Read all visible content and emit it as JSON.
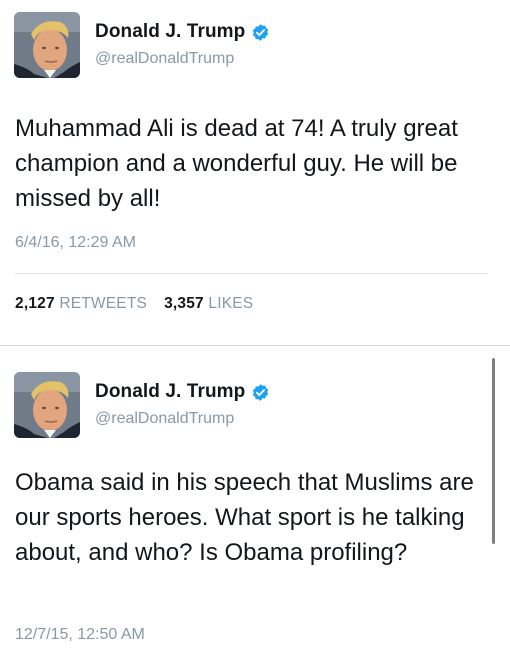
{
  "tweets": [
    {
      "display_name": "Donald J. Trump",
      "handle": "@realDonaldTrump",
      "text": "Muhammad Ali is dead at 74! A truly great champion and a wonderful guy. He will be missed by all!",
      "timestamp": "6/4/16, 12:29 AM",
      "retweets_count": "2,127",
      "retweets_label": "RETWEETS",
      "likes_count": "3,357",
      "likes_label": "LIKES"
    },
    {
      "display_name": "Donald J. Trump",
      "handle": "@realDonaldTrump",
      "text": "Obama said in his speech that Muslims are our sports heroes. What sport is he talking about, and who? Is Obama profiling?",
      "timestamp": "12/7/15, 12:50 AM"
    }
  ],
  "icons": {
    "verified": "verified-badge-icon",
    "avatar": "profile-photo"
  },
  "colors": {
    "verified_blue": "#1da1f2",
    "text_primary": "#14171a",
    "text_secondary": "#8899a6"
  }
}
